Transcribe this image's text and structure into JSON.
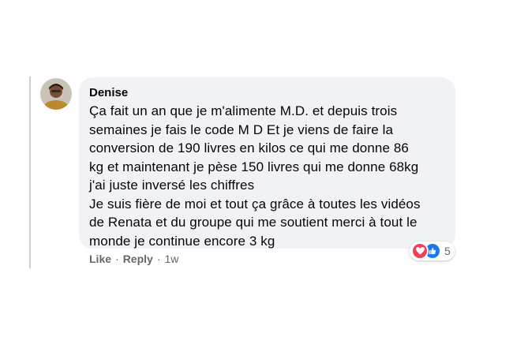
{
  "comment": {
    "author": "Denise",
    "lines": [
      "Ça fait un an que je m'alimente M.D. et depuis trois",
      "semaines je fais le code M D Et je viens de faire la",
      "conversion de 190 livres en kilos ce qui me donne 86",
      "kg et maintenant je pèse 150 livres qui me donne 68kg",
      "j'ai juste inversé les chiffres",
      "Je suis fière de moi et tout ça grâce à toutes les vidéos",
      "de Renata et du groupe qui me soutient merci à tout le",
      "monde je continue encore 3 kg"
    ],
    "reactions": {
      "icons": [
        "love-icon",
        "like-icon"
      ],
      "count": "5"
    }
  },
  "actions": {
    "like_label": "Like",
    "separator": "·",
    "reply_label": "Reply",
    "timestamp": "1w"
  },
  "colors": {
    "bubble": "#f0f2f5",
    "text": "#050505",
    "secondary_text": "#65676b",
    "love": "#f33e58",
    "like": "#1877f2"
  }
}
